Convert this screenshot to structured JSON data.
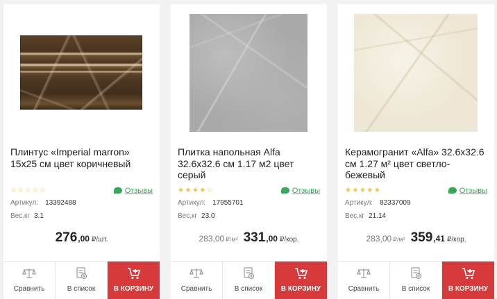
{
  "products": [
    {
      "title": "Плинтус «Imperial marron» 15x25 см цвет коричневый",
      "rating": 0,
      "reviews_label": "Отзывы",
      "article_label": "Артикул:",
      "article": "13392488",
      "weight_label": "Вес,кг",
      "weight": "3.1",
      "old_price": "",
      "old_unit": "",
      "price_int": "276",
      "price_frac": ",00",
      "price_unit": "₽/шт.",
      "compare_label": "Сравнить",
      "list_label": "В список",
      "cart_label": "В КОРЗИНУ"
    },
    {
      "title": "Плитка напольная Alfa 32.6x32.6 см 1.17 м2 цвет серый",
      "rating": 4,
      "reviews_label": "Отзывы",
      "article_label": "Артикул:",
      "article": "17955701",
      "weight_label": "Вес,кг",
      "weight": "23.0",
      "old_price": "283,00",
      "old_unit": "₽/м²",
      "price_int": "331",
      "price_frac": ",00",
      "price_unit": "₽/кор.",
      "compare_label": "Сравнить",
      "list_label": "В список",
      "cart_label": "В КОРЗИНУ"
    },
    {
      "title": "Керамогранит «Alfa» 32.6x32.6 см 1.27 м² цвет светло-бежевый",
      "rating": 5,
      "reviews_label": "Отзывы",
      "article_label": "Артикул:",
      "article": "82337009",
      "weight_label": "Вес,кг",
      "weight": "21.14",
      "old_price": "283,00",
      "old_unit": "₽/м²",
      "price_int": "359",
      "price_frac": ",41",
      "price_unit": "₽/кор.",
      "compare_label": "Сравнить",
      "list_label": "В список",
      "cart_label": "В КОРЗИНУ"
    }
  ],
  "colors": {
    "accent_red": "#d63a3a",
    "reviews_green": "#39a85b",
    "star_yellow": "#e7c34a"
  },
  "icons": {
    "compare": "scales-icon",
    "list": "list-icon",
    "cart": "cart-icon",
    "reviews": "chat-bubble-icon",
    "star": "star-icon"
  }
}
